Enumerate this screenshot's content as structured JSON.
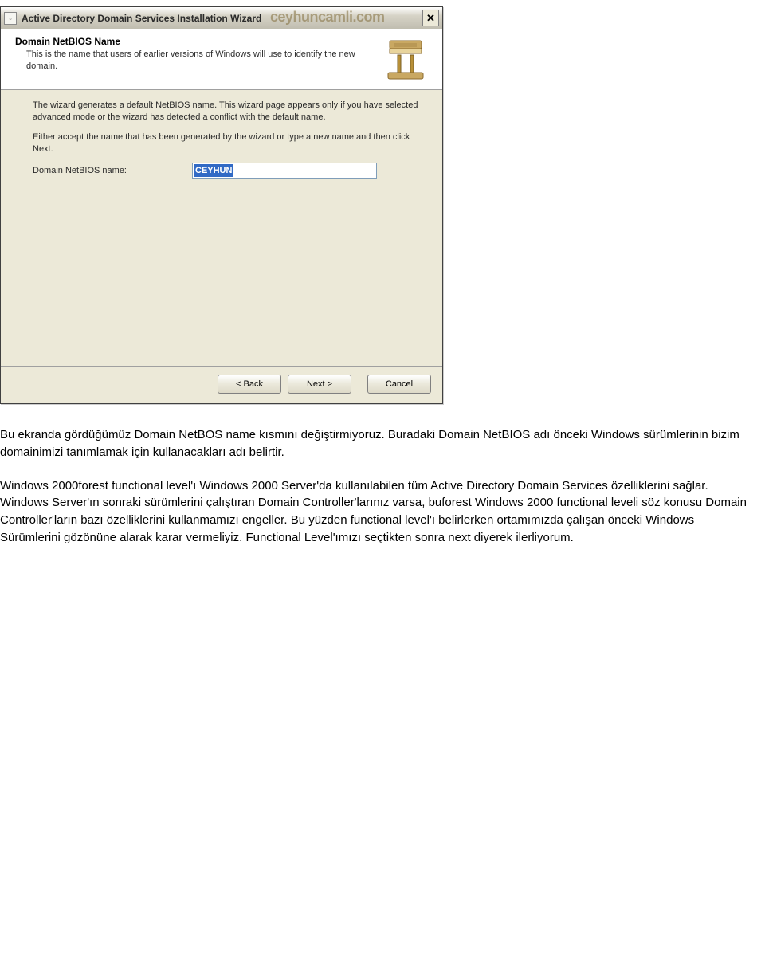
{
  "dialog": {
    "title": "Active Directory Domain Services Installation Wizard",
    "watermark": "ceyhuncamli.com",
    "close": "✕",
    "banner": {
      "heading": "Domain NetBIOS Name",
      "description": "This is the name that users of earlier versions of Windows will use to identify the new domain."
    },
    "content": {
      "para1": "The wizard generates a default NetBIOS name. This wizard page appears only if you have selected advanced mode or the wizard has detected a conflict with the default name.",
      "para2": "Either accept the name that has been generated by the wizard or type a new name and then click Next.",
      "field_label": "Domain NetBIOS name:",
      "field_value": "CEYHUN"
    },
    "buttons": {
      "back": "< Back",
      "next": "Next >",
      "cancel": "Cancel"
    }
  },
  "article": {
    "p1": "Bu ekranda gördüğümüz Domain NetBOS name kısmını değiştirmiyoruz. Buradaki Domain NetBIOS adı önceki Windows sürümlerinin bizim domainimizi tanımlamak için kullanacakları adı belirtir.",
    "p2": "Windows 2000forest functional level'ı Windows 2000 Server'da kullanılabilen tüm Active Directory Domain Services özelliklerini sağlar. Windows Server'ın sonraki sürümlerini çalıştıran Domain Controller'larınız varsa, buforest Windows 2000 functional leveli söz konusu Domain Controller'ların bazı özelliklerini kullanmamızı engeller. Bu yüzden functional level'ı belirlerken ortamımızda çalışan önceki Windows Sürümlerini gözönüne alarak karar vermeliyiz. Functional Level'ımızı seçtikten sonra next diyerek ilerliyorum."
  }
}
